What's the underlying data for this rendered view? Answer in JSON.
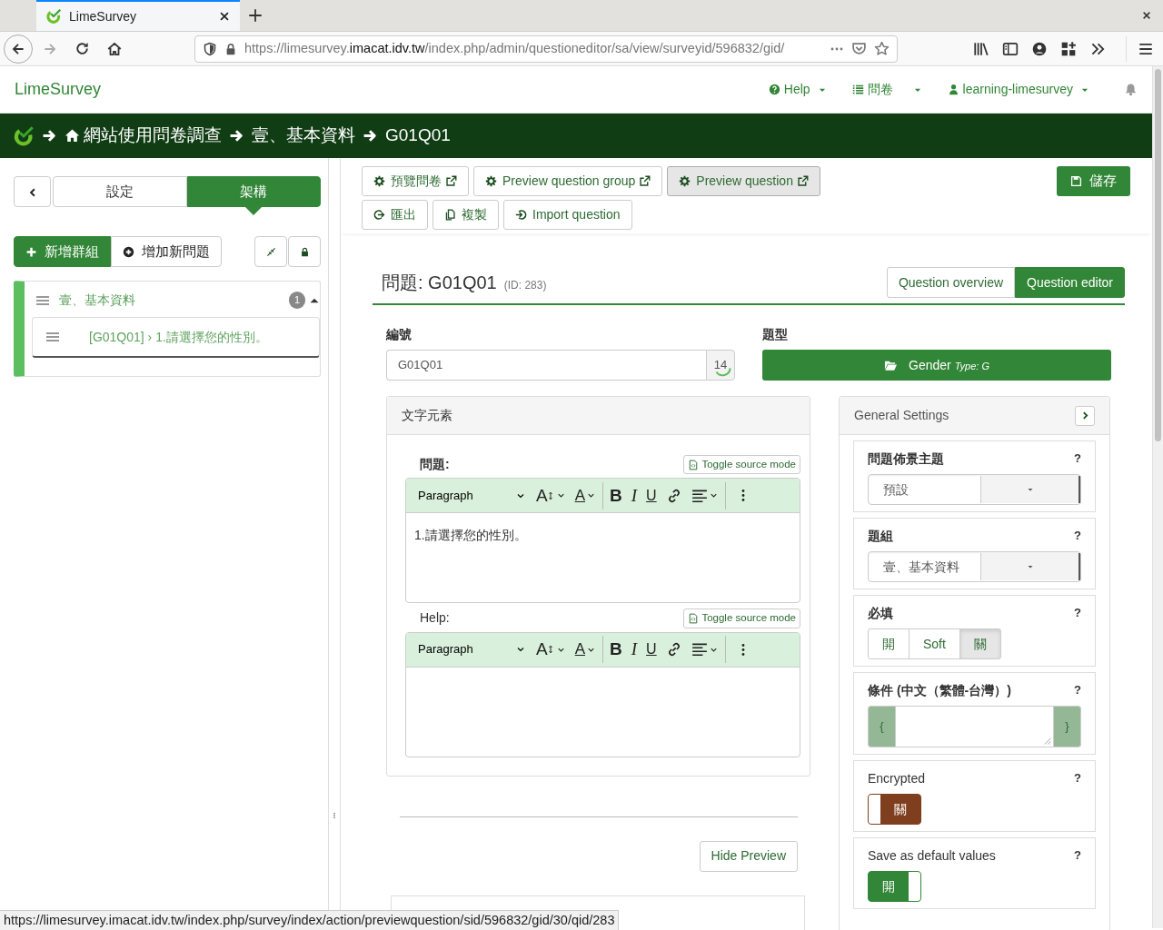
{
  "browser": {
    "tab_title": "LimeSurvey",
    "url_prefix": "https://limesurvey.",
    "url_domain": "imacat.idv.tw",
    "url_path": "/index.php/admin/questioneditor/sa/view/surveyid/596832/gid/",
    "status_url": "https://limesurvey.imacat.idv.tw/index.php/survey/index/action/previewquestion/sid/596832/gid/30/qid/283"
  },
  "navbar": {
    "brand": "LimeSurvey",
    "items": [
      {
        "kind": "help",
        "label": "Help"
      },
      {
        "kind": "surveys",
        "label": "問卷"
      },
      {
        "kind": "user",
        "label": "learning-limesurvey"
      }
    ]
  },
  "breadcrumb": [
    "網站使用問卷調查",
    "壹、基本資料",
    "G01Q01"
  ],
  "sidebar": {
    "tabs": [
      {
        "label": "設定",
        "selected": false
      },
      {
        "label": "架構",
        "selected": true
      }
    ],
    "buttons": [
      {
        "kind": "add-group",
        "label": "新增群組"
      },
      {
        "kind": "add-question",
        "label": "增加新問題"
      }
    ],
    "groups": [
      {
        "title": "壹、基本資料",
        "count": "1",
        "expanded": true,
        "children": [
          {
            "label": "[G01Q01] › 1.請選擇您的性別。"
          }
        ]
      }
    ]
  },
  "toolbar": {
    "buttons": [
      {
        "kind": "preview",
        "label": "預覽問卷",
        "hover": false
      },
      {
        "kind": "preview",
        "label": "Preview question group",
        "hover": false
      },
      {
        "kind": "preview",
        "label": "Preview question",
        "hover": true
      },
      {
        "kind": "export",
        "label": "匯出",
        "hover": false
      },
      {
        "kind": "copy",
        "label": "複製",
        "hover": false
      },
      {
        "kind": "import",
        "label": "Import question",
        "hover": false
      }
    ],
    "save": "儲存"
  },
  "question": {
    "label": "問題:",
    "code": "G01Q01",
    "id": "(ID: 283)",
    "views": [
      {
        "label": "Question overview",
        "selected": false
      },
      {
        "label": "Question editor",
        "selected": true
      }
    ],
    "code_label": "編號",
    "code_value": "G01Q01",
    "char_count": "14",
    "type_label": "題型",
    "type_name": "Gender",
    "type_code": "Type: G"
  },
  "text_elements": {
    "title": "文字元素",
    "editors": [
      {
        "label": "問題:",
        "strong": true,
        "toggle": "Toggle source mode",
        "format": "Paragraph",
        "tools": [
          {
            "kind": "font-size",
            "label": "A"
          },
          {
            "kind": "font-color",
            "label": "A"
          },
          {
            "kind": "bold",
            "label": "B"
          },
          {
            "kind": "italic",
            "label": "I"
          },
          {
            "kind": "underline",
            "label": "U"
          },
          {
            "kind": "link"
          },
          {
            "kind": "align"
          },
          {
            "kind": "more"
          }
        ],
        "content": "1.請選擇您的性別。"
      },
      {
        "label": "Help:",
        "strong": false,
        "toggle": "Toggle source mode",
        "format": "Paragraph",
        "tools": [
          {
            "kind": "font-size",
            "label": "A"
          },
          {
            "kind": "font-color",
            "label": "A"
          },
          {
            "kind": "bold",
            "label": "B"
          },
          {
            "kind": "italic",
            "label": "I"
          },
          {
            "kind": "underline",
            "label": "U"
          },
          {
            "kind": "link"
          },
          {
            "kind": "align"
          },
          {
            "kind": "more"
          }
        ]
      }
    ]
  },
  "hide_preview": "Hide Preview",
  "general_settings": {
    "title": "General Settings",
    "items": [
      {
        "kind": "select",
        "label": "問題佈景主題",
        "help": "?",
        "value": "預設"
      },
      {
        "kind": "select",
        "label": "題組",
        "help": "?",
        "value": "壹、基本資料"
      },
      {
        "kind": "segmented",
        "label": "必填",
        "help": "?",
        "options": [
          {
            "label": "開",
            "selected": false
          },
          {
            "label": "Soft",
            "selected": false
          },
          {
            "label": "關",
            "selected": true
          }
        ]
      },
      {
        "kind": "textarea",
        "label": "條件 (中文（繁體-台灣）)",
        "help": "?",
        "open": "{",
        "close": "}"
      },
      {
        "kind": "switch",
        "label": "Encrypted",
        "help": "?",
        "on": false,
        "text": "關"
      },
      {
        "kind": "switch",
        "label": "Save as default values",
        "help": "?",
        "on": true,
        "text": "開"
      }
    ]
  }
}
